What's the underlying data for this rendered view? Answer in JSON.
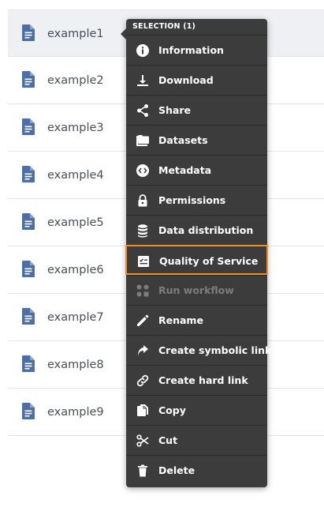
{
  "files": [
    {
      "name": "example1",
      "selected": true
    },
    {
      "name": "example2",
      "selected": false
    },
    {
      "name": "example3",
      "selected": false
    },
    {
      "name": "example4",
      "selected": false
    },
    {
      "name": "example5",
      "selected": false
    },
    {
      "name": "example6",
      "selected": false
    },
    {
      "name": "example7",
      "selected": false
    },
    {
      "name": "example8",
      "selected": false
    },
    {
      "name": "example9",
      "selected": false
    }
  ],
  "context_menu": {
    "header": "SELECTION (1)",
    "items": [
      {
        "label": "Information",
        "icon": "info-icon"
      },
      {
        "label": "Download",
        "icon": "download-icon"
      },
      {
        "label": "Share",
        "icon": "share-icon"
      },
      {
        "label": "Datasets",
        "icon": "datasets-icon"
      },
      {
        "label": "Metadata",
        "icon": "metadata-icon"
      },
      {
        "label": "Permissions",
        "icon": "lock-icon"
      },
      {
        "label": "Data distribution",
        "icon": "database-icon"
      },
      {
        "label": "Quality of Service",
        "icon": "qos-icon",
        "highlighted": true
      },
      {
        "label": "Run workflow",
        "icon": "workflow-icon",
        "disabled": true
      },
      {
        "label": "Rename",
        "icon": "pencil-icon"
      },
      {
        "label": "Create symbolic link",
        "icon": "symlink-icon"
      },
      {
        "label": "Create hard link",
        "icon": "hardlink-icon"
      },
      {
        "label": "Copy",
        "icon": "copy-icon"
      },
      {
        "label": "Cut",
        "icon": "scissors-icon"
      },
      {
        "label": "Delete",
        "icon": "trash-icon"
      }
    ]
  },
  "colors": {
    "file_icon": "#4f6ea3",
    "menu_bg": "#3c3c3c",
    "highlight_border": "#f28c28",
    "disabled_text": "#7d7d7d"
  }
}
